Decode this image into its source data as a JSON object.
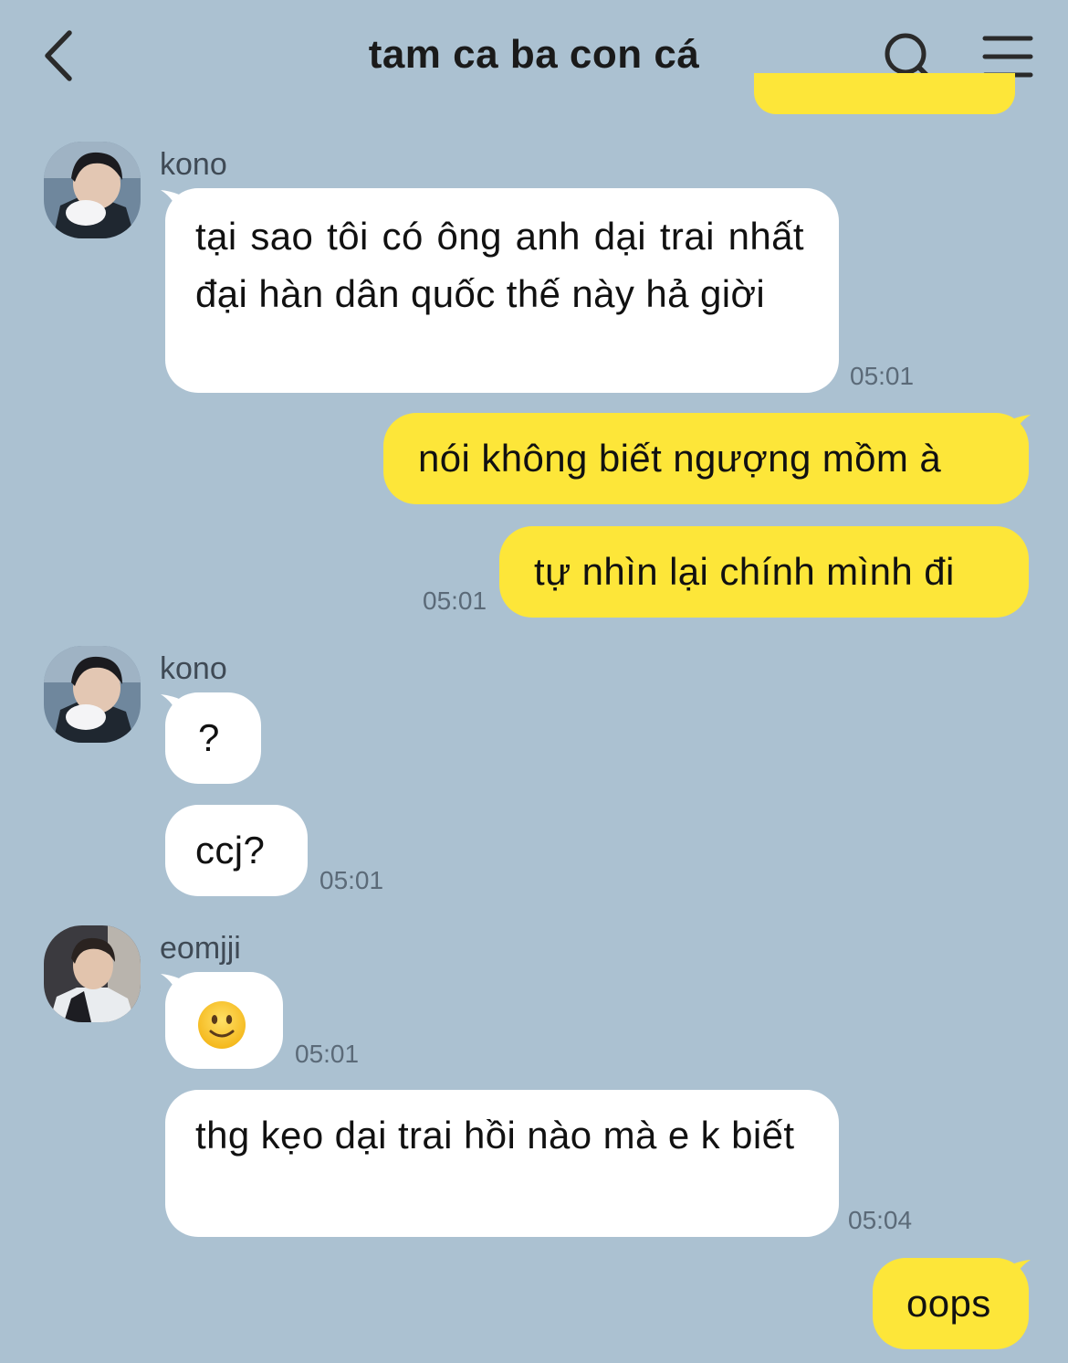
{
  "header": {
    "title": "tam ca ba con cá"
  },
  "messages": [
    {
      "sender": "kono",
      "text": "tại sao tôi có ông anh dại trai nhất đại hàn dân quốc thế này hả giời",
      "time": "05:01"
    },
    {
      "text": "nói không biết ngượng mồm à"
    },
    {
      "text": "tự nhìn lại chính mình đi",
      "time": "05:01"
    },
    {
      "sender": "kono",
      "text": "?"
    },
    {
      "text": "ccj?",
      "time": "05:01"
    },
    {
      "sender": "eomjji",
      "emoji": "slightly-smiling-face",
      "time": "05:01"
    },
    {
      "text": "thg kẹo dại trai hồi nào mà e k biết",
      "time": "05:04"
    },
    {
      "text": "oops"
    }
  ],
  "colors": {
    "background": "#abc1d1",
    "outgoing_bubble": "#fde639",
    "incoming_bubble": "#ffffff",
    "timestamp": "#5b6a78"
  }
}
